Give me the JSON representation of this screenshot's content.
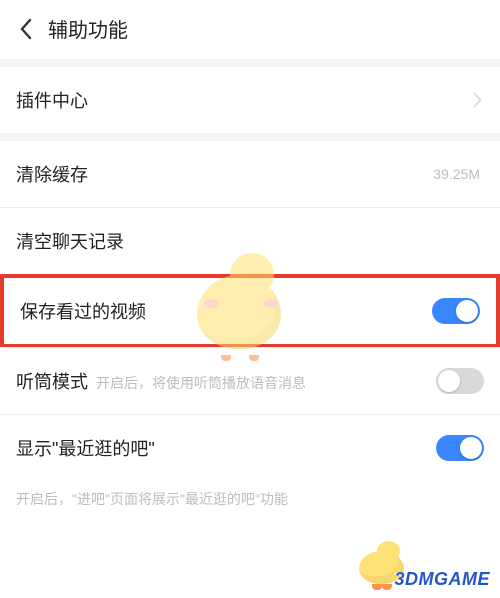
{
  "header": {
    "title": "辅助功能"
  },
  "rows": {
    "plugin_center": {
      "label": "插件中心"
    },
    "clear_cache": {
      "label": "清除缓存",
      "value": "39.25M"
    },
    "clear_chat": {
      "label": "清空聊天记录"
    },
    "save_video": {
      "label": "保存看过的视频",
      "on": true
    },
    "earpiece": {
      "label": "听筒模式",
      "sub": "开启后，将使用听筒播放语音消息",
      "on": false
    },
    "recent_bar": {
      "label": "显示\"最近逛的吧\"",
      "on": true
    }
  },
  "desc_recent_bar": "开启后，\"进吧\"页面将展示\"最近逛的吧\"功能",
  "watermark": "3DMGAME"
}
